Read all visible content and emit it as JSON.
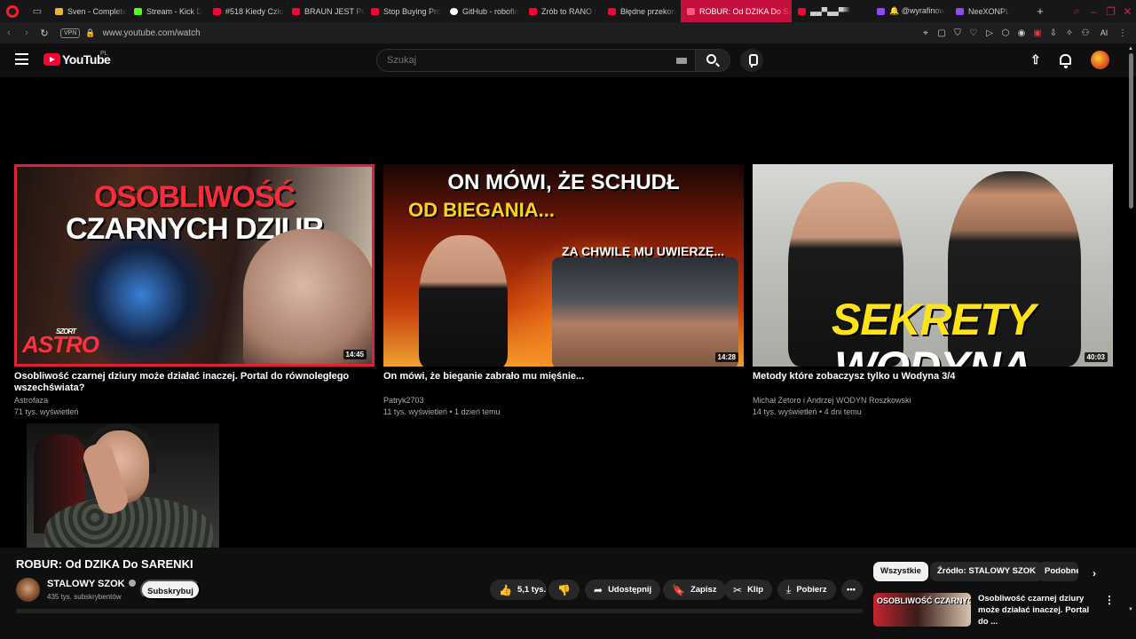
{
  "browser": {
    "tabs": [
      {
        "label": "Sven - Complete",
        "color": "#e8b43a",
        "active": false
      },
      {
        "label": "Stream - Kick D",
        "color": "#53fc18",
        "active": false
      },
      {
        "label": "#518 Kiedy Czło",
        "color": "#ff0033",
        "active": false
      },
      {
        "label": "BRAUN JEST PO",
        "color": "#ff0033",
        "active": false
      },
      {
        "label": "Stop Buying Pro",
        "color": "#ff0033",
        "active": false
      },
      {
        "label": "GitHub - roboflo",
        "color": "#ffffff",
        "active": false
      },
      {
        "label": "Zrób to RANO i",
        "color": "#ff0033",
        "active": false
      },
      {
        "label": "Błędne przekon",
        "color": "#ff0033",
        "active": false
      },
      {
        "label": "ROBUR: Od DZIKA Do SAR",
        "color": "#ff0033",
        "active": true
      },
      {
        "label": "▄▄▀▄▄▀▀",
        "color": "#ff0033",
        "active": false
      },
      {
        "label": "🔔 @wyrafinow",
        "color": "#9146ff",
        "active": false
      },
      {
        "label": "NeeXONPL",
        "color": "#9146ff",
        "active": false
      }
    ],
    "vpn": "VPN",
    "url": "www.youtube.com/watch",
    "ai_label": "AI"
  },
  "youtube": {
    "logo_text": "YouTube",
    "country": "PL",
    "search_placeholder": "Szukaj"
  },
  "end_screen": [
    {
      "title": "Osobliwość czarnej dziury może działać inaczej. Portal do równoległego wszechświata?",
      "channel": "Astrofaza",
      "stats": "71 tys. wyświetleń",
      "duration": "14:45",
      "thumb_text_red": "OSOBLIWOŚĆ",
      "thumb_text_white": "CZARNYCH DZIUR",
      "thumb_badge": "ASTRO",
      "thumb_badge_small": "SZORT"
    },
    {
      "title": "On mówi, że bieganie zabrało mu mięśnie...",
      "channel": "Patryk2703",
      "stats": "11 tys. wyświetleń • 1 dzień temu",
      "duration": "14:28",
      "thumb_line1": "ON MÓWI, ŻE SCHUDŁ",
      "thumb_line2": "OD BIEGANIA...",
      "thumb_line3": "ZA CHWILĘ MU UWIERZĘ..."
    },
    {
      "title": "Metody które zobaczysz tylko u Wodyna 3/4",
      "channel": "Michał Zetoro i Andrzej WODYN Roszkowski",
      "stats": "14 tys. wyświetleń • 4 dni temu",
      "duration": "40:03",
      "thumb_text_yellow": "SEKRETY",
      "thumb_text_white": "WODYNA"
    }
  ],
  "video": {
    "title": "ROBUR: Od DZIKA Do SARENKI",
    "channel": "STALOWY SZOK",
    "subscribers": "435 tys. subskrybentów",
    "subscribe_label": "Subskrybuj",
    "likes": "5,1 tys.",
    "share_label": "Udostępnij",
    "save_label": "Zapisz",
    "clip_label": "Klip",
    "download_label": "Pobierz"
  },
  "sidebar": {
    "chips": [
      "Wszystkie",
      "Źródło: STALOWY SZOK",
      "Podobne"
    ],
    "suggestion": {
      "title": "Osobliwość czarnej dziury może działać inaczej. Portal do ...",
      "thumb_text": "OSOBLIWOŚĆ CZARNYCH DZIUR"
    }
  }
}
